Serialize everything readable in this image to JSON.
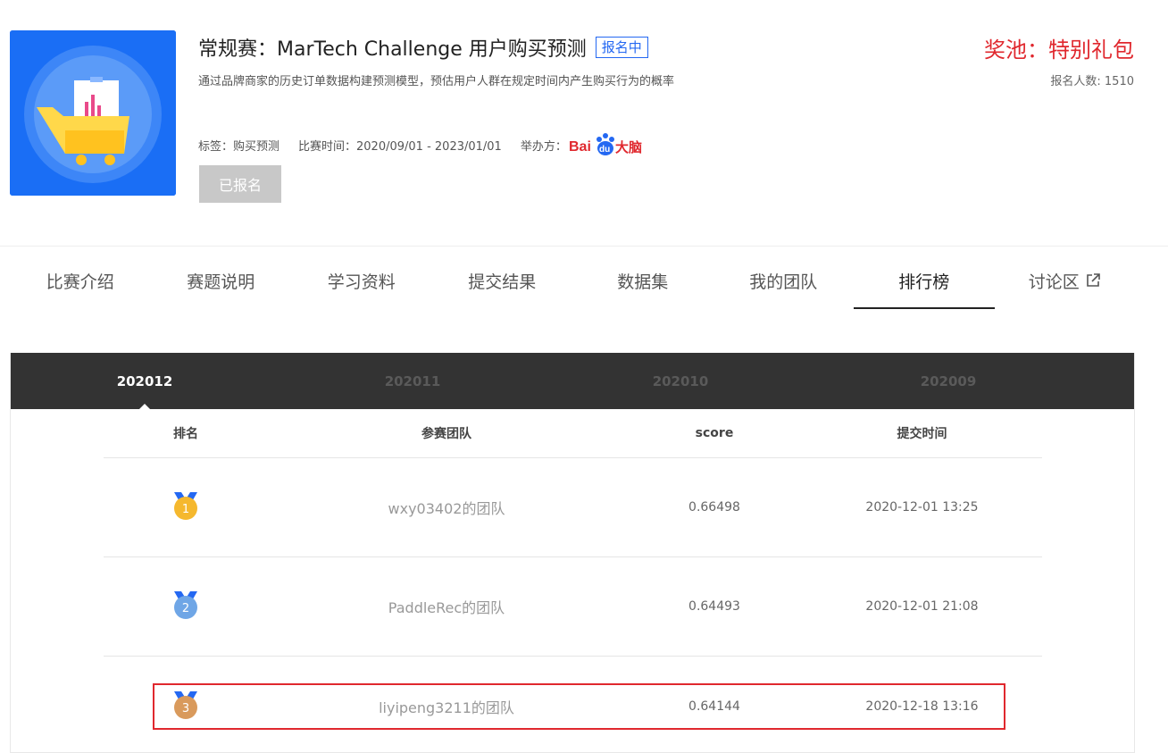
{
  "header": {
    "title": "常规赛：MarTech Challenge 用户购买预测",
    "status_badge": "报名中",
    "description": "通过品牌商家的历史订单数据构建预测模型，预估用户人群在规定时间内产生购买行为的概率",
    "prize": "奖池：特别礼包",
    "signup_count": "报名人数: 1510",
    "tags": "标签：购买预测",
    "time": "比赛时间：2020/09/01 - 2023/01/01",
    "organizer_label": "举办方：",
    "organizer_logo": "Bai du 大脑",
    "signed_button": "已报名"
  },
  "tabs": [
    {
      "label": "比赛介绍"
    },
    {
      "label": "赛题说明"
    },
    {
      "label": "学习资料"
    },
    {
      "label": "提交结果"
    },
    {
      "label": "数据集"
    },
    {
      "label": "我的团队"
    },
    {
      "label": "排行榜",
      "active": true
    },
    {
      "label": "讨论区",
      "external": true
    }
  ],
  "leaderboard": {
    "months": [
      "202012",
      "202011",
      "202010",
      "202009"
    ],
    "active_month": "202012",
    "columns": [
      "排名",
      "参赛团队",
      "score",
      "提交时间"
    ],
    "rows": [
      {
        "rank": "1",
        "team": "wxy03402的团队",
        "score": "0.66498",
        "time": "2020-12-01 13:25"
      },
      {
        "rank": "2",
        "team": "PaddleRec的团队",
        "score": "0.64493",
        "time": "2020-12-01 21:08"
      },
      {
        "rank": "3",
        "team": "liyipeng3211的团队",
        "score": "0.64144",
        "time": "2020-12-18 13:16"
      }
    ]
  },
  "colors": {
    "accent_blue": "#2468f2",
    "prize_red": "#e0282e",
    "highlight_red": "#e0282e",
    "gold": "#f5b82e",
    "silver": "#6fa6e6",
    "bronze": "#d99a5c"
  }
}
